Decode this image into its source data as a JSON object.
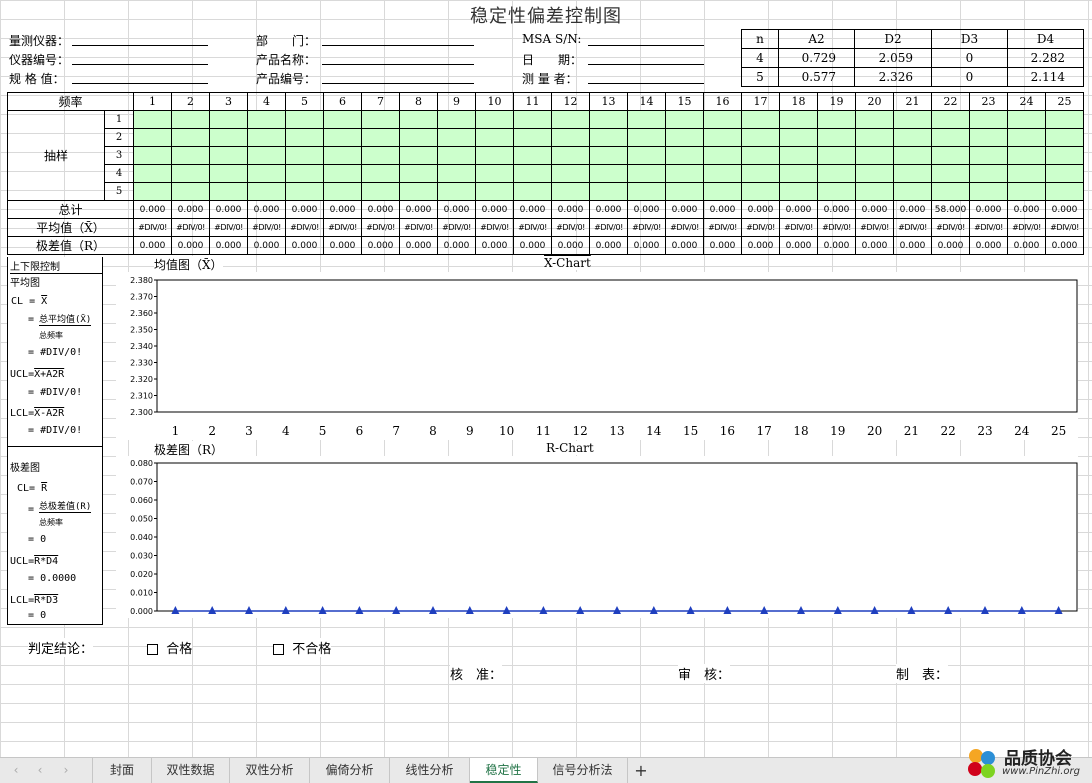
{
  "title": "稳定性偏差控制图",
  "header": {
    "instrument": "量测仪器：",
    "instrument_no": "仪器编号：",
    "spec": "规 格 值：",
    "dept": "部　　门：",
    "product_name": "产品名称：",
    "product_no": "产品编号：",
    "msa": "MSA S/N:",
    "date": "日　　期：",
    "measurer": "测 量 者："
  },
  "constants": {
    "headers": [
      "n",
      "A2",
      "D2",
      "D3",
      "D4"
    ],
    "rows": [
      [
        "4",
        "0.729",
        "2.059",
        "0",
        "2.282"
      ],
      [
        "5",
        "0.577",
        "2.326",
        "0",
        "2.114"
      ]
    ]
  },
  "table": {
    "freq_label": "频率",
    "sample_label": "抽样",
    "total_label": "总计",
    "mean_label": "平均值（X̄）",
    "range_label": "极差值（R）",
    "columns": [
      "1",
      "2",
      "3",
      "4",
      "5",
      "6",
      "7",
      "8",
      "9",
      "10",
      "11",
      "12",
      "13",
      "14",
      "15",
      "16",
      "17",
      "18",
      "19",
      "20",
      "21",
      "22",
      "23",
      "24",
      "25"
    ],
    "sample_rows": [
      "1",
      "2",
      "3",
      "4",
      "5"
    ],
    "totals": [
      "0.000",
      "0.000",
      "0.000",
      "0.000",
      "0.000",
      "0.000",
      "0.000",
      "0.000",
      "0.000",
      "0.000",
      "0.000",
      "0.000",
      "0.000",
      "0.000",
      "0.000",
      "0.000",
      "0.000",
      "0.000",
      "0.000",
      "0.000",
      "0.000",
      "58.000",
      "0.000",
      "0.000",
      "0.000"
    ],
    "means": [
      "#DIV/0!",
      "#DIV/0!",
      "#DIV/0!",
      "#DIV/0!",
      "#DIV/0!",
      "#DIV/0!",
      "#DIV/0!",
      "#DIV/0!",
      "#DIV/0!",
      "#DIV/0!",
      "#DIV/0!",
      "#DIV/0!",
      "#DIV/0!",
      "#DIV/0!",
      "#DIV/0!",
      "#DIV/0!",
      "#DIV/0!",
      "#DIV/0!",
      "#DIV/0!",
      "#DIV/0!",
      "#DIV/0!",
      "#DIV/0!",
      "#DIV/0!",
      "#DIV/0!",
      "#DIV/0!"
    ],
    "ranges": [
      "0.000",
      "0.000",
      "0.000",
      "0.000",
      "0.000",
      "0.000",
      "0.000",
      "0.000",
      "0.000",
      "0.000",
      "0.000",
      "0.000",
      "0.000",
      "0.000",
      "0.000",
      "0.000",
      "0.000",
      "0.000",
      "0.000",
      "0.000",
      "0.000",
      "0.000",
      "0.000",
      "0.000",
      "0.000"
    ]
  },
  "left": {
    "limits_title": "上下限控制",
    "mean_chart": "平均图",
    "cl": "CL",
    "xbar": "X",
    "avg_total": "总平均值(X̄)",
    "freq_total": "总频率",
    "div0": "#DIV/0!",
    "ucl": "UCL",
    "ucl_expr": "X+A2R",
    "lcl": "LCL",
    "lcl_expr": "X-A2R",
    "range_chart": "极差图",
    "rbar": "R",
    "range_total": "总极差值(R)",
    "zero": "0",
    "ucl_r_expr": "R*D4",
    "ucl_r_val": "0.0000",
    "lcl_r_expr": "R*D3",
    "eq": "="
  },
  "xbar_chart": {
    "label": "均值图（X̄）",
    "title": "X-Chart"
  },
  "r_chart": {
    "label": "极差图（R）",
    "title": "R-Chart"
  },
  "chart_data": [
    {
      "type": "line",
      "title": "X̄-Chart",
      "x": [
        1,
        2,
        3,
        4,
        5,
        6,
        7,
        8,
        9,
        10,
        11,
        12,
        13,
        14,
        15,
        16,
        17,
        18,
        19,
        20,
        21,
        22,
        23,
        24,
        25
      ],
      "series": [],
      "ylim": [
        2.3,
        2.38
      ],
      "yticks": [
        "2.300",
        "2.310",
        "2.320",
        "2.330",
        "2.340",
        "2.350",
        "2.360",
        "2.370",
        "2.380"
      ],
      "grid": false
    },
    {
      "type": "line",
      "title": "R-Chart",
      "x": [
        1,
        2,
        3,
        4,
        5,
        6,
        7,
        8,
        9,
        10,
        11,
        12,
        13,
        14,
        15,
        16,
        17,
        18,
        19,
        20,
        21,
        22,
        23,
        24,
        25
      ],
      "series": [
        {
          "values": [
            0,
            0,
            0,
            0,
            0,
            0,
            0,
            0,
            0,
            0,
            0,
            0,
            0,
            0,
            0,
            0,
            0,
            0,
            0,
            0,
            0,
            0,
            0,
            0,
            0
          ],
          "color": "#1f3fbf"
        }
      ],
      "ylim": [
        0,
        0.08
      ],
      "yticks": [
        "0.000",
        "0.010",
        "0.020",
        "0.030",
        "0.040",
        "0.050",
        "0.060",
        "0.070",
        "0.080"
      ],
      "grid": false
    }
  ],
  "conclusion": {
    "label": "判定结论：",
    "pass": "合格",
    "fail": "不合格"
  },
  "sign": {
    "approve": "核　准：",
    "review": "审　核：",
    "make": "制　表："
  },
  "sheet_tabs": [
    "封面",
    "双性数据",
    "双性分析",
    "偏倚分析",
    "线性分析",
    "稳定性",
    "信号分析法"
  ],
  "active_tab": "稳定性",
  "add_tab": "+",
  "logo": {
    "text": "品质协会",
    "url": "www.PinZhi.org"
  },
  "colors": {
    "sample_fill": "#ccffcc",
    "active_tab": "#217346",
    "series": "#1f3fbf"
  }
}
